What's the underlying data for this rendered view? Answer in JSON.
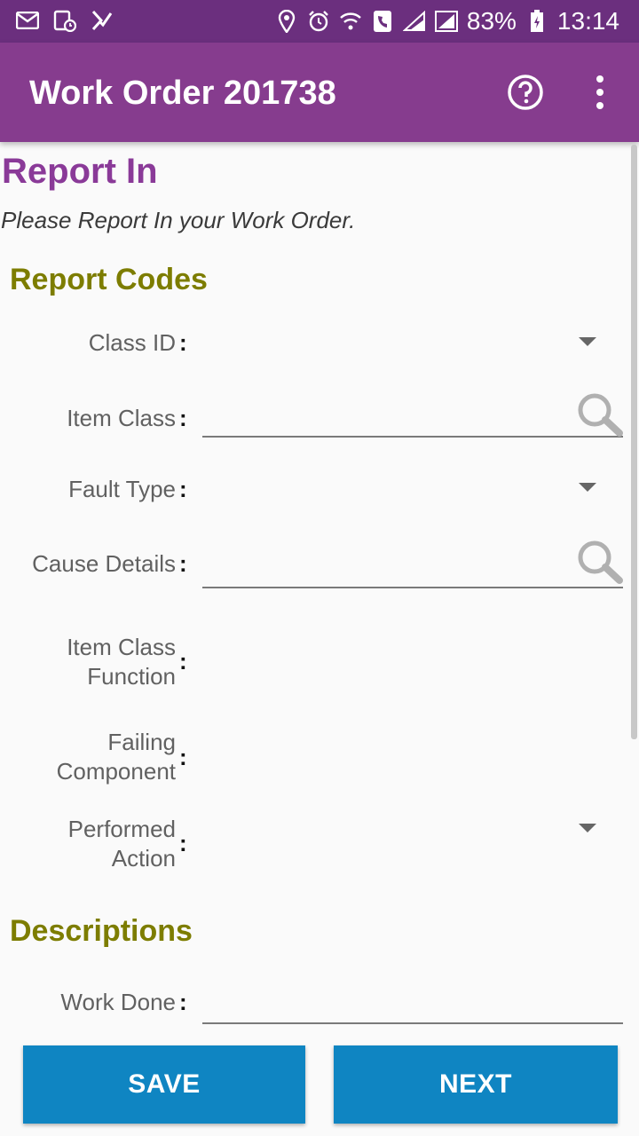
{
  "status_bar": {
    "battery": "83%",
    "time": "13:14",
    "icons_left": [
      "mail-icon",
      "calendar-icon",
      "check-icon"
    ],
    "icons_right": [
      "location-icon",
      "alarm-icon",
      "wifi-icon",
      "call-icon",
      "signal-icon",
      "signal-icon",
      "battery-icon"
    ]
  },
  "app_bar": {
    "title": "Work Order 201738",
    "icons": [
      "help-icon",
      "more-vert-icon"
    ]
  },
  "page": {
    "title": "Report In",
    "subtitle": "Please Report In your Work Order."
  },
  "report_codes": {
    "heading": "Report Codes",
    "fields": {
      "class_id": "Class ID",
      "item_class": "Item Class",
      "fault_type": "Fault Type",
      "cause_details": "Cause Details",
      "item_class_function_1": "Item Class",
      "item_class_function_2": "Function",
      "failing_component_1": "Failing",
      "failing_component_2": "Component",
      "performed_action_1": "Performed",
      "performed_action_2": "Action"
    },
    "colon": ":"
  },
  "descriptions": {
    "heading": "Descriptions",
    "work_done": "Work Done"
  },
  "buttons": {
    "save": "SAVE",
    "next": "NEXT"
  },
  "colors": {
    "status_bar": "#6b2f7e",
    "app_bar": "#863c8e",
    "title_purple": "#8a3a98",
    "heading_olive": "#7d7d00",
    "button_blue": "#0f85c2"
  }
}
